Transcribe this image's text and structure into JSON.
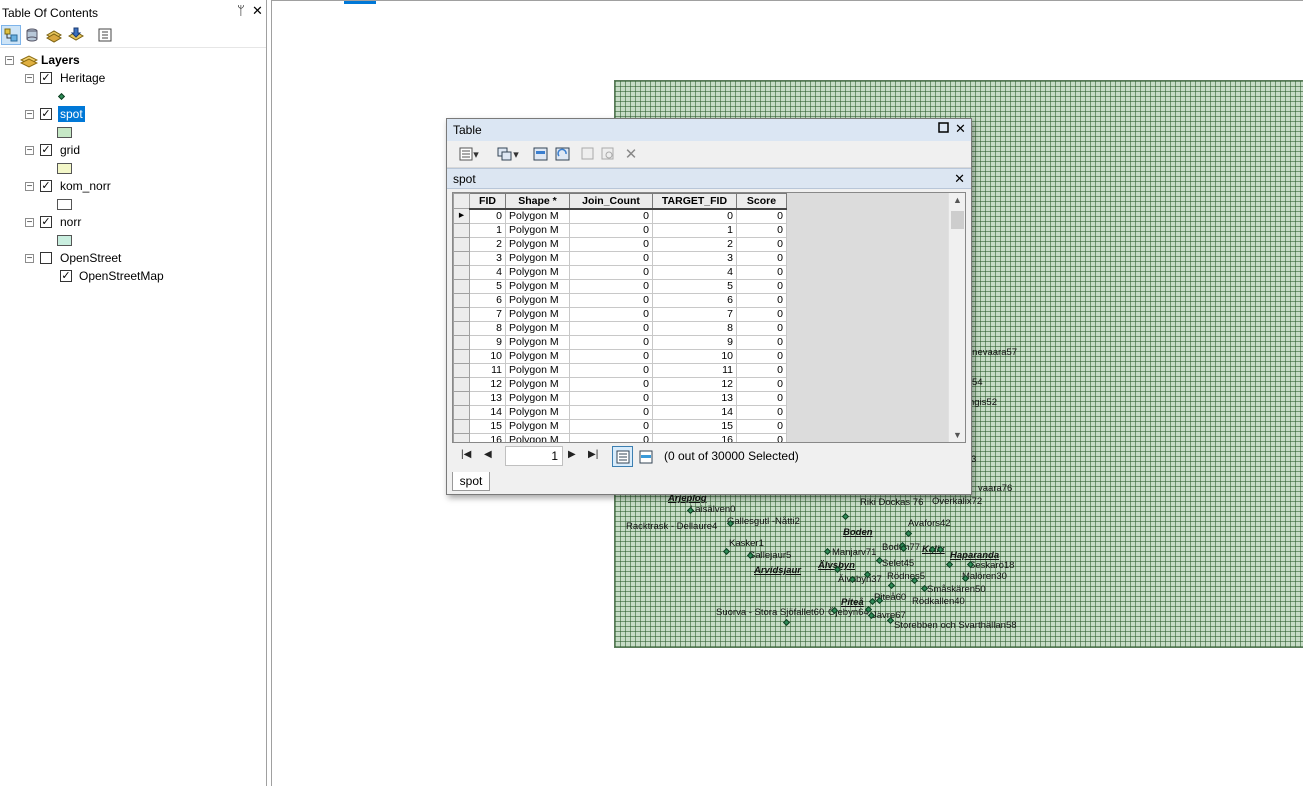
{
  "toc": {
    "title": "Table Of Contents",
    "pin_glyph": "ᛘ",
    "close_glyph": "✕",
    "root_label": "Layers",
    "layers": [
      {
        "name": "Heritage",
        "checked": true,
        "selected": false,
        "symbol": "point",
        "color": "#2e8b57"
      },
      {
        "name": "spot",
        "checked": true,
        "selected": true,
        "symbol": "fill",
        "color": "#c6e8c6"
      },
      {
        "name": "grid",
        "checked": true,
        "selected": false,
        "symbol": "fill",
        "color": "#f3f7c8"
      },
      {
        "name": "kom_norr",
        "checked": true,
        "selected": false,
        "symbol": "fill",
        "color": "#ffffff"
      },
      {
        "name": "norr",
        "checked": true,
        "selected": false,
        "symbol": "fill",
        "color": "#c9eedf"
      },
      {
        "name": "OpenStreet",
        "checked": false,
        "selected": false,
        "symbol": "group",
        "color": ""
      }
    ],
    "sublayer": {
      "name": "OpenStreetMap",
      "checked": true
    }
  },
  "map": {
    "grid_color": "#c6dcc6",
    "places": [
      {
        "text": "rnevaara57",
        "town": false
      },
      {
        "text": "54",
        "town": false
      },
      {
        "text": "ngis52",
        "town": false
      },
      {
        "text": "3",
        "town": false
      },
      {
        "text": "vaara76",
        "town": false
      },
      {
        "text": "Arjeplog",
        "town": true
      },
      {
        "text": "Laisälven0",
        "town": false
      },
      {
        "text": "Riki Dockas 76",
        "town": false
      },
      {
        "text": "Overkalix72",
        "town": false
      },
      {
        "text": "Gallesgutl -Nåtti2",
        "town": false
      },
      {
        "text": "Racktrask - Dellaure4",
        "town": false
      },
      {
        "text": "Boden",
        "town": true
      },
      {
        "text": "Avafors42",
        "town": false
      },
      {
        "text": "Kasker1",
        "town": false
      },
      {
        "text": "Gallejaur5",
        "town": false
      },
      {
        "text": "Manjarv71",
        "town": false
      },
      {
        "text": "Boden77",
        "town": false
      },
      {
        "text": "Kalix",
        "town": true
      },
      {
        "text": "Haparanda",
        "town": true
      },
      {
        "text": "Selet45",
        "town": false
      },
      {
        "text": "Seskarö18",
        "town": false
      },
      {
        "text": "Arvidsjaur",
        "town": true
      },
      {
        "text": "Älvsbyn",
        "town": true
      },
      {
        "text": "Älvsbyn37",
        "town": false
      },
      {
        "text": "Rödnes5",
        "town": false
      },
      {
        "text": "Malören30",
        "town": false
      },
      {
        "text": "Småskären50",
        "town": false
      },
      {
        "text": "Piteå60",
        "town": false
      },
      {
        "text": "Rödkallen40",
        "town": false
      },
      {
        "text": "Piteå",
        "town": true
      },
      {
        "text": "Suorva - Stora Sjöfallet60",
        "town": false
      },
      {
        "text": "Öjebyn64",
        "town": false
      },
      {
        "text": "Jävre67",
        "town": false
      },
      {
        "text": "Storebben och Svarthällan58",
        "town": false
      }
    ]
  },
  "table_window": {
    "title": "Table",
    "tab_name": "spot",
    "columns": [
      "FID",
      "Shape *",
      "Join_Count",
      "TARGET_FID",
      "Score"
    ],
    "rows": [
      [
        "0",
        "Polygon M",
        "0",
        "0",
        "0"
      ],
      [
        "1",
        "Polygon M",
        "0",
        "1",
        "0"
      ],
      [
        "2",
        "Polygon M",
        "0",
        "2",
        "0"
      ],
      [
        "3",
        "Polygon M",
        "0",
        "3",
        "0"
      ],
      [
        "4",
        "Polygon M",
        "0",
        "4",
        "0"
      ],
      [
        "5",
        "Polygon M",
        "0",
        "5",
        "0"
      ],
      [
        "6",
        "Polygon M",
        "0",
        "6",
        "0"
      ],
      [
        "7",
        "Polygon M",
        "0",
        "7",
        "0"
      ],
      [
        "8",
        "Polygon M",
        "0",
        "8",
        "0"
      ],
      [
        "9",
        "Polygon M",
        "0",
        "9",
        "0"
      ],
      [
        "10",
        "Polygon M",
        "0",
        "10",
        "0"
      ],
      [
        "11",
        "Polygon M",
        "0",
        "11",
        "0"
      ],
      [
        "12",
        "Polygon M",
        "0",
        "12",
        "0"
      ],
      [
        "13",
        "Polygon M",
        "0",
        "13",
        "0"
      ],
      [
        "14",
        "Polygon M",
        "0",
        "14",
        "0"
      ],
      [
        "15",
        "Polygon M",
        "0",
        "15",
        "0"
      ],
      [
        "16",
        "Polygon M",
        "0",
        "16",
        "0"
      ]
    ],
    "current_record": "1",
    "selection_status": "(0 out of 30000 Selected)",
    "bottom_tab": "spot"
  }
}
